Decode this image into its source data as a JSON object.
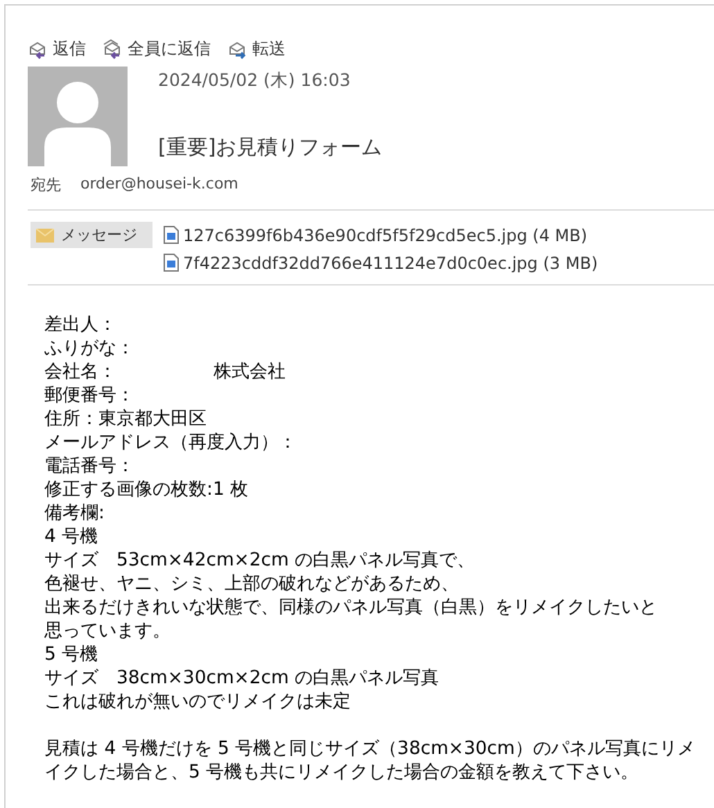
{
  "actions": [
    {
      "kind": "reply",
      "label": "返信"
    },
    {
      "kind": "reply_all",
      "label": "全員に返信"
    },
    {
      "kind": "forward",
      "label": "転送"
    }
  ],
  "message": {
    "date": "2024/05/02 (木) 16:03",
    "subject": "[重要]お見積りフォーム",
    "to_label": "宛先",
    "to": "order@housei-k.com"
  },
  "attachments": {
    "message_tab": {
      "label": "メッセージ",
      "selected": true
    },
    "files": [
      "127c6399f6b436e90cdf5f5f29cd5ec5.jpg (4 MB)",
      "7f4223cddf32dd766e411124e7d0c0ec.jpg (3 MB)"
    ]
  },
  "body": [
    {
      "kind": "text",
      "label": "差出人："
    },
    {
      "kind": "text",
      "label": "ふりがな："
    },
    {
      "kind": "text",
      "label": "会社名：",
      "value": "株式会社"
    },
    {
      "kind": "text",
      "label": "郵便番号："
    },
    {
      "kind": "text",
      "label": "住所：東京都大田区"
    },
    {
      "kind": "text",
      "label": "メールアドレス（再度入力）："
    },
    {
      "kind": "text",
      "label": "電話番号："
    },
    {
      "kind": "text",
      "label": "修正する画像の枚数:1 枚"
    },
    {
      "kind": "text",
      "label": "備考欄:"
    },
    {
      "kind": "text",
      "label": "4 号機"
    },
    {
      "kind": "text",
      "label": "サイズ　53cm×42cm×2cm の白黒パネル写真で、"
    },
    {
      "kind": "text",
      "label": "色褪せ、ヤニ、シミ、上部の破れなどがあるため、"
    },
    {
      "kind": "text",
      "label": "出来るだけきれいな状態で、同様のパネル写真（白黒）をリメイクしたいと"
    },
    {
      "kind": "text",
      "label": "思っています。"
    },
    {
      "kind": "text",
      "label": "5 号機"
    },
    {
      "kind": "text",
      "label": "サイズ　38cm×30cm×2cm の白黒パネル写真"
    },
    {
      "kind": "text",
      "label": "これは破れが無いのでリメイクは未定"
    },
    {
      "kind": "blank"
    },
    {
      "kind": "text",
      "label": "見積は 4 号機だけを 5 号機と同じサイズ（38cm×30cm）のパネル写真にリメ"
    },
    {
      "kind": "text",
      "label": "イクした場合と、5 号機も共にリメイクした場合の金額を教えて下さい。"
    }
  ]
}
